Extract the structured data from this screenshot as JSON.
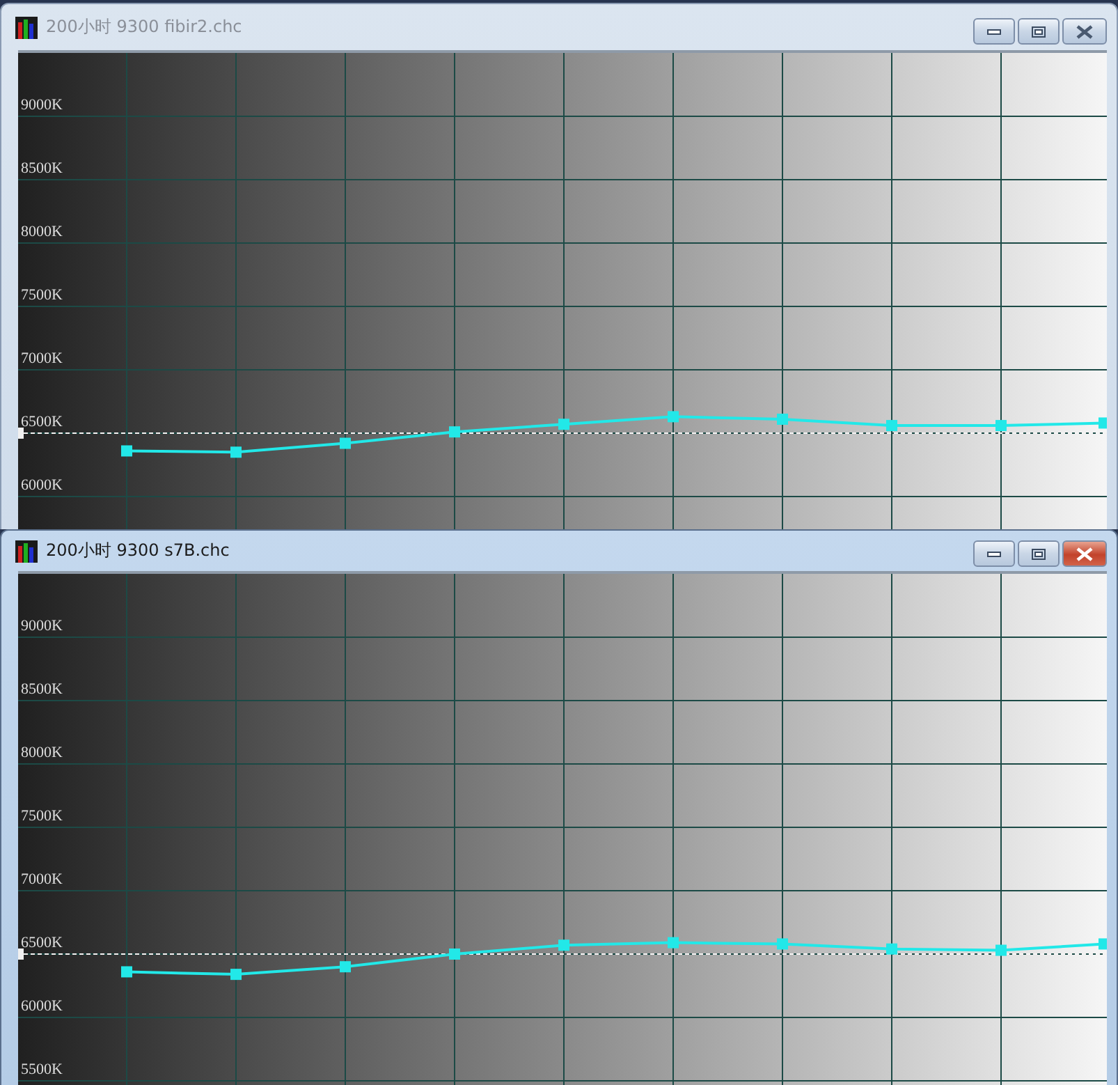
{
  "windows": [
    {
      "title": "200小时 9300 fibir2.chc",
      "active": false,
      "chart": {
        "chart_data": {
          "type": "line",
          "ylim": [
            5710,
            9500
          ],
          "yticks": [
            {
              "value": 6000,
              "label": "6000K"
            },
            {
              "value": 6500,
              "label": "6500K"
            },
            {
              "value": 7000,
              "label": "7000K"
            },
            {
              "value": 7500,
              "label": "7500K"
            },
            {
              "value": 8000,
              "label": "8000K"
            },
            {
              "value": 8500,
              "label": "8500K"
            },
            {
              "value": 9000,
              "label": "9000K"
            }
          ],
          "grid": true,
          "series": [
            {
              "color": "#22e8e8",
              "marker": "square",
              "values": [
                6360,
                6350,
                6420,
                6510,
                6570,
                6630,
                6610,
                6560,
                6560,
                6580
              ]
            }
          ],
          "ref_lines": [
            {
              "axis": "y",
              "value": 6500
            }
          ]
        }
      }
    },
    {
      "title": "200小时 9300 s7B.chc",
      "active": true,
      "chart": {
        "chart_data": {
          "type": "line",
          "ylim": [
            5445,
            9500
          ],
          "yticks": [
            {
              "value": 5500,
              "label": "5500K"
            },
            {
              "value": 6000,
              "label": "6000K"
            },
            {
              "value": 6500,
              "label": "6500K"
            },
            {
              "value": 7000,
              "label": "7000K"
            },
            {
              "value": 7500,
              "label": "7500K"
            },
            {
              "value": 8000,
              "label": "8000K"
            },
            {
              "value": 8500,
              "label": "8500K"
            },
            {
              "value": 9000,
              "label": "9000K"
            }
          ],
          "grid": true,
          "series": [
            {
              "color": "#22e8e8",
              "marker": "square",
              "values": [
                6360,
                6340,
                6400,
                6500,
                6570,
                6590,
                6580,
                6540,
                6530,
                6580
              ]
            }
          ],
          "ref_lines": [
            {
              "axis": "y",
              "value": 6500
            }
          ]
        }
      }
    }
  ]
}
